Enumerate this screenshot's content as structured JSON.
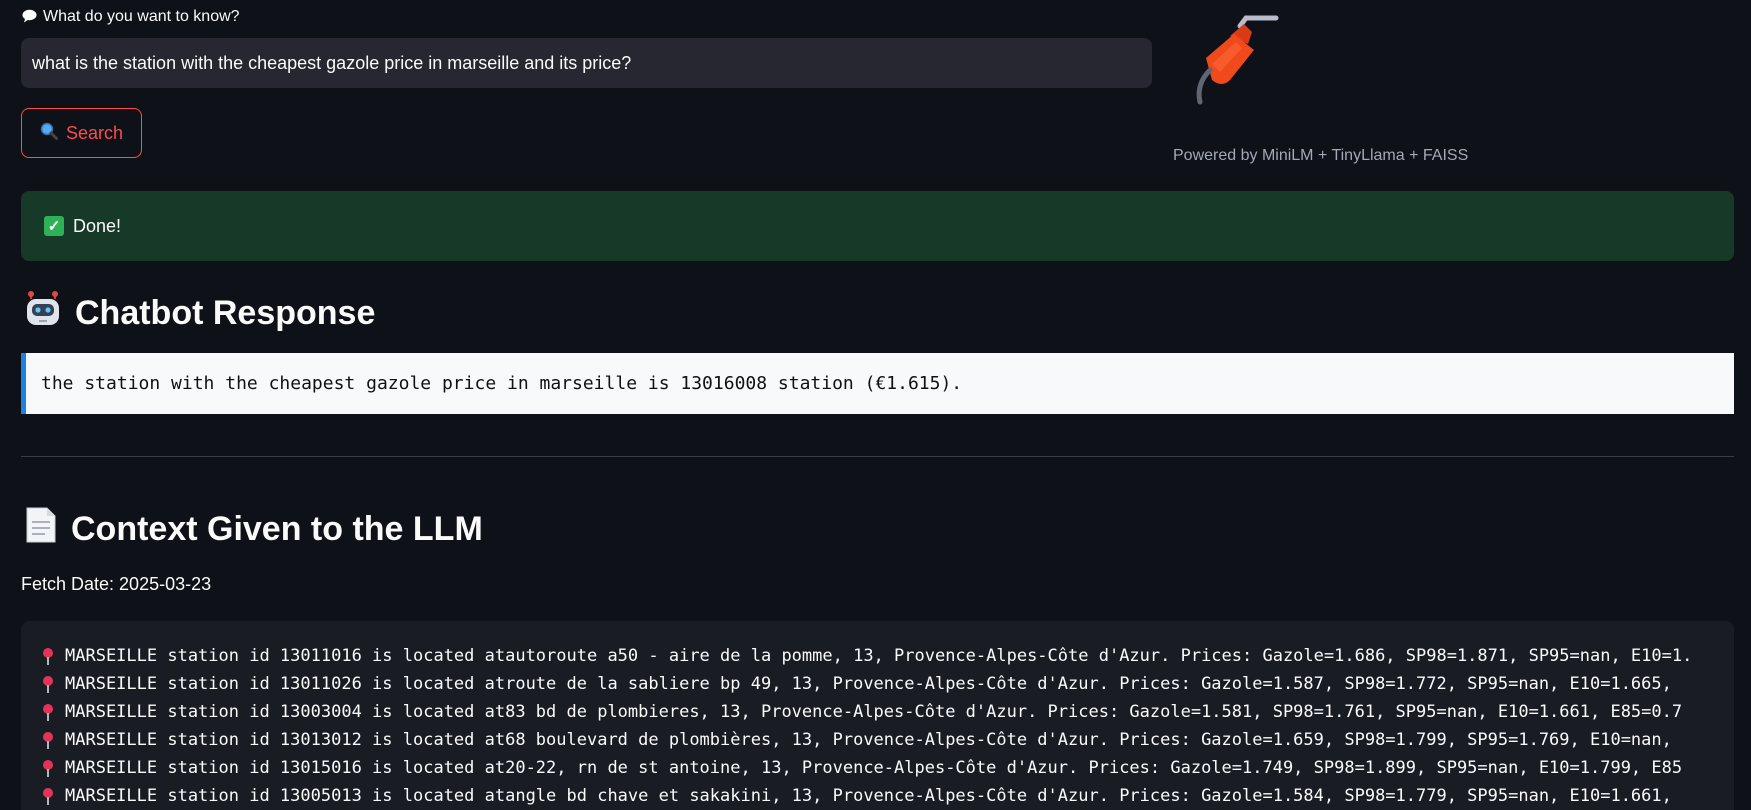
{
  "query": {
    "label": "What do you want to know?",
    "value": "what is the station with the cheapest gazole price in marseille and its price?",
    "label_icon": "speech-bubble-icon"
  },
  "search_button": {
    "label": "Search",
    "icon": "magnifier-icon"
  },
  "logo": {
    "icon": "fuel-pump-icon"
  },
  "powered_by": "Powered by MiniLM + TinyLlama + FAISS",
  "status": {
    "text": "Done!",
    "icon": "check-icon",
    "color": "#173928"
  },
  "chatbot": {
    "heading": "Chatbot Response",
    "icon": "robot-icon",
    "response": "the station with the cheapest gazole price in marseille is 13016008 station (€1.615)."
  },
  "context": {
    "heading": "Context Given to the LLM",
    "icon": "document-icon",
    "fetch_date": "Fetch Date: 2025-03-23",
    "lines": [
      "MARSEILLE station id 13011016 is located atautoroute a50 - aire de la pomme, 13, Provence-Alpes-Côte d'Azur. Prices: Gazole=1.686, SP98=1.871, SP95=nan, E10=1.",
      "MARSEILLE station id 13011026 is located atroute de la sabliere bp 49, 13, Provence-Alpes-Côte d'Azur. Prices: Gazole=1.587, SP98=1.772, SP95=nan, E10=1.665,",
      "MARSEILLE station id 13003004 is located at83 bd de plombieres, 13, Provence-Alpes-Côte d'Azur. Prices: Gazole=1.581, SP98=1.761, SP95=nan, E10=1.661, E85=0.7",
      "MARSEILLE station id 13013012 is located at68 boulevard de plombières, 13, Provence-Alpes-Côte d'Azur. Prices: Gazole=1.659, SP98=1.799, SP95=1.769, E10=nan,",
      "MARSEILLE station id 13015016 is located at20-22, rn de st antoine, 13, Provence-Alpes-Côte d'Azur. Prices: Gazole=1.749, SP98=1.899, SP95=nan, E10=1.799, E85",
      "MARSEILLE station id 13005013 is located atangle bd chave et sakakini, 13, Provence-Alpes-Côte d'Azur. Prices: Gazole=1.584, SP98=1.779, SP95=nan, E10=1.661,"
    ]
  }
}
